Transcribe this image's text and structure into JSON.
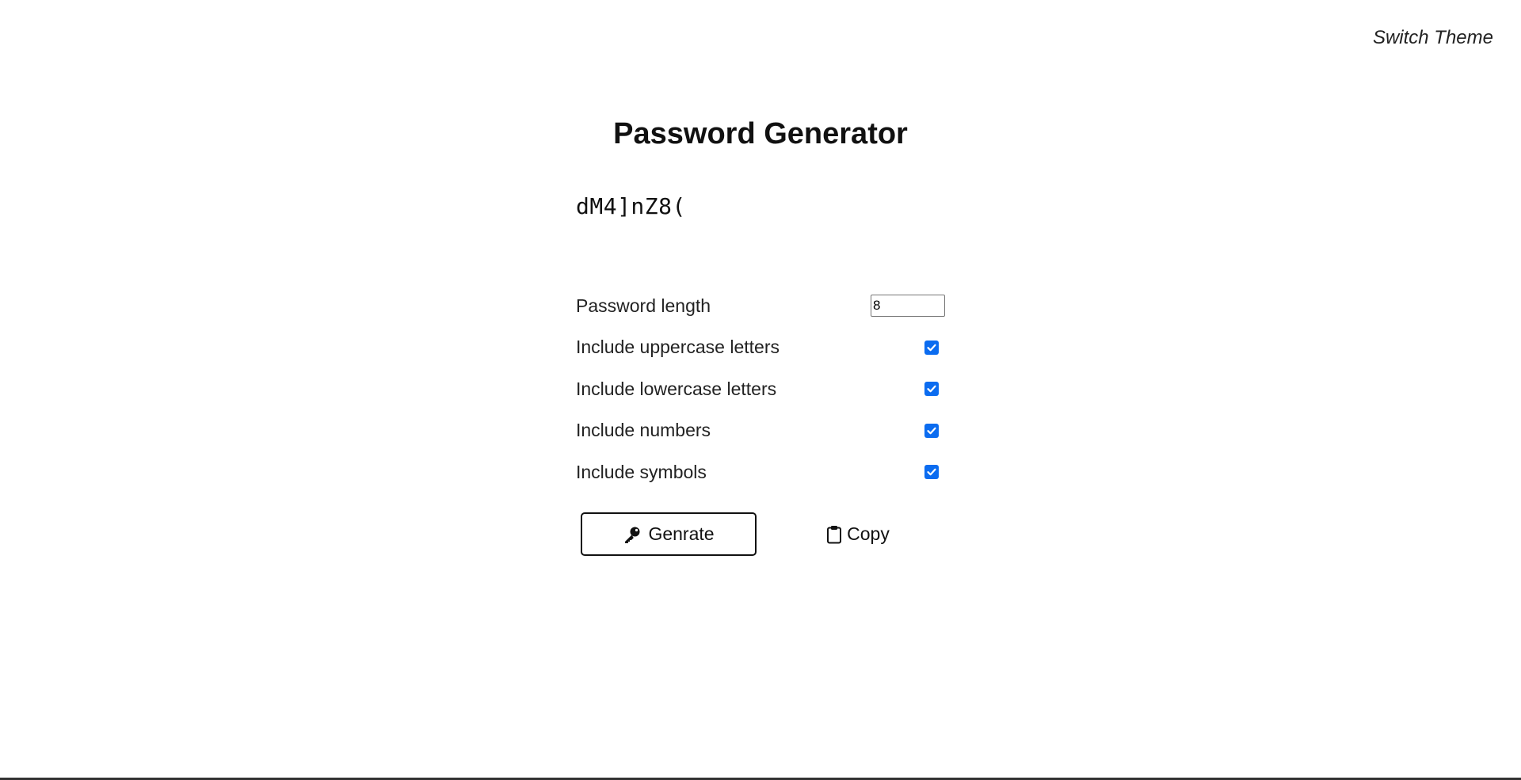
{
  "header": {
    "theme_toggle_label": "Switch Theme"
  },
  "main": {
    "title": "Password Generator",
    "generated_password": "dM4]nZ8("
  },
  "settings": {
    "length": {
      "label": "Password length",
      "value": "8"
    },
    "uppercase": {
      "label": "Include uppercase letters",
      "checked": true
    },
    "lowercase": {
      "label": "Include lowercase letters",
      "checked": true
    },
    "numbers": {
      "label": "Include numbers",
      "checked": true
    },
    "symbols": {
      "label": "Include symbols",
      "checked": true
    }
  },
  "actions": {
    "generate_label": "Genrate",
    "copy_label": "Copy"
  },
  "icons": {
    "generate": "key-icon",
    "copy": "clipboard-icon"
  },
  "colors": {
    "checkbox_accent": "#0b6cf0"
  }
}
